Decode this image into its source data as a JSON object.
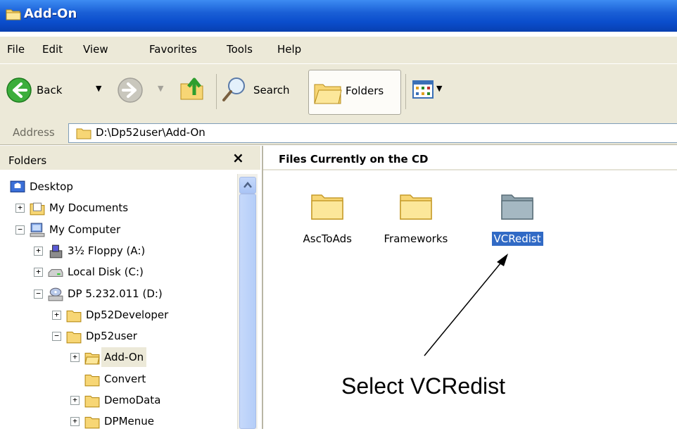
{
  "window": {
    "title": "Add-On"
  },
  "menu": [
    "File",
    "Edit",
    "View",
    "Favorites",
    "Tools",
    "Help"
  ],
  "toolbar": {
    "back_label": "Back",
    "search_label": "Search",
    "folders_label": "Folders"
  },
  "address": {
    "label": "Address",
    "path": "D:\\Dp52user\\Add-On"
  },
  "folders_pane": {
    "title": "Folders",
    "close_symbol": "×",
    "items": [
      {
        "label": "Desktop",
        "icon": "desktop-icon",
        "expander": ""
      },
      {
        "label": "My Documents",
        "icon": "documents-icon",
        "expander": "+"
      },
      {
        "label": "My Computer",
        "icon": "computer-icon",
        "expander": "−"
      },
      {
        "label": "3½ Floppy (A:)",
        "icon": "floppy-icon",
        "expander": "+"
      },
      {
        "label": "Local Disk (C:)",
        "icon": "disk-icon",
        "expander": "+"
      },
      {
        "label": "DP 5.232.011 (D:)",
        "icon": "cd-drive-icon",
        "expander": "−"
      },
      {
        "label": "Dp52Developer",
        "icon": "folder-icon",
        "expander": "+"
      },
      {
        "label": "Dp52user",
        "icon": "folder-icon",
        "expander": "−"
      },
      {
        "label": "Add-On",
        "icon": "folder-open-icon",
        "expander": "+"
      },
      {
        "label": "Convert",
        "icon": "folder-icon",
        "expander": ""
      },
      {
        "label": "DemoData",
        "icon": "folder-icon",
        "expander": "+"
      },
      {
        "label": "DPMenue",
        "icon": "folder-icon",
        "expander": "+"
      }
    ]
  },
  "content": {
    "header": "Files Currently on the CD",
    "files": [
      {
        "label": "AscToAds",
        "icon": "folder-icon",
        "selected": false
      },
      {
        "label": "Frameworks",
        "icon": "folder-icon",
        "selected": false
      },
      {
        "label": "VCRedist",
        "icon": "folder-icon",
        "selected": true
      }
    ]
  },
  "annotation": {
    "text": "Select VCRedist"
  },
  "colors": {
    "title_bar": "#0a4dcc",
    "chrome": "#ECE9D8",
    "selection": "#316ac5",
    "folder": "#f7d675"
  }
}
